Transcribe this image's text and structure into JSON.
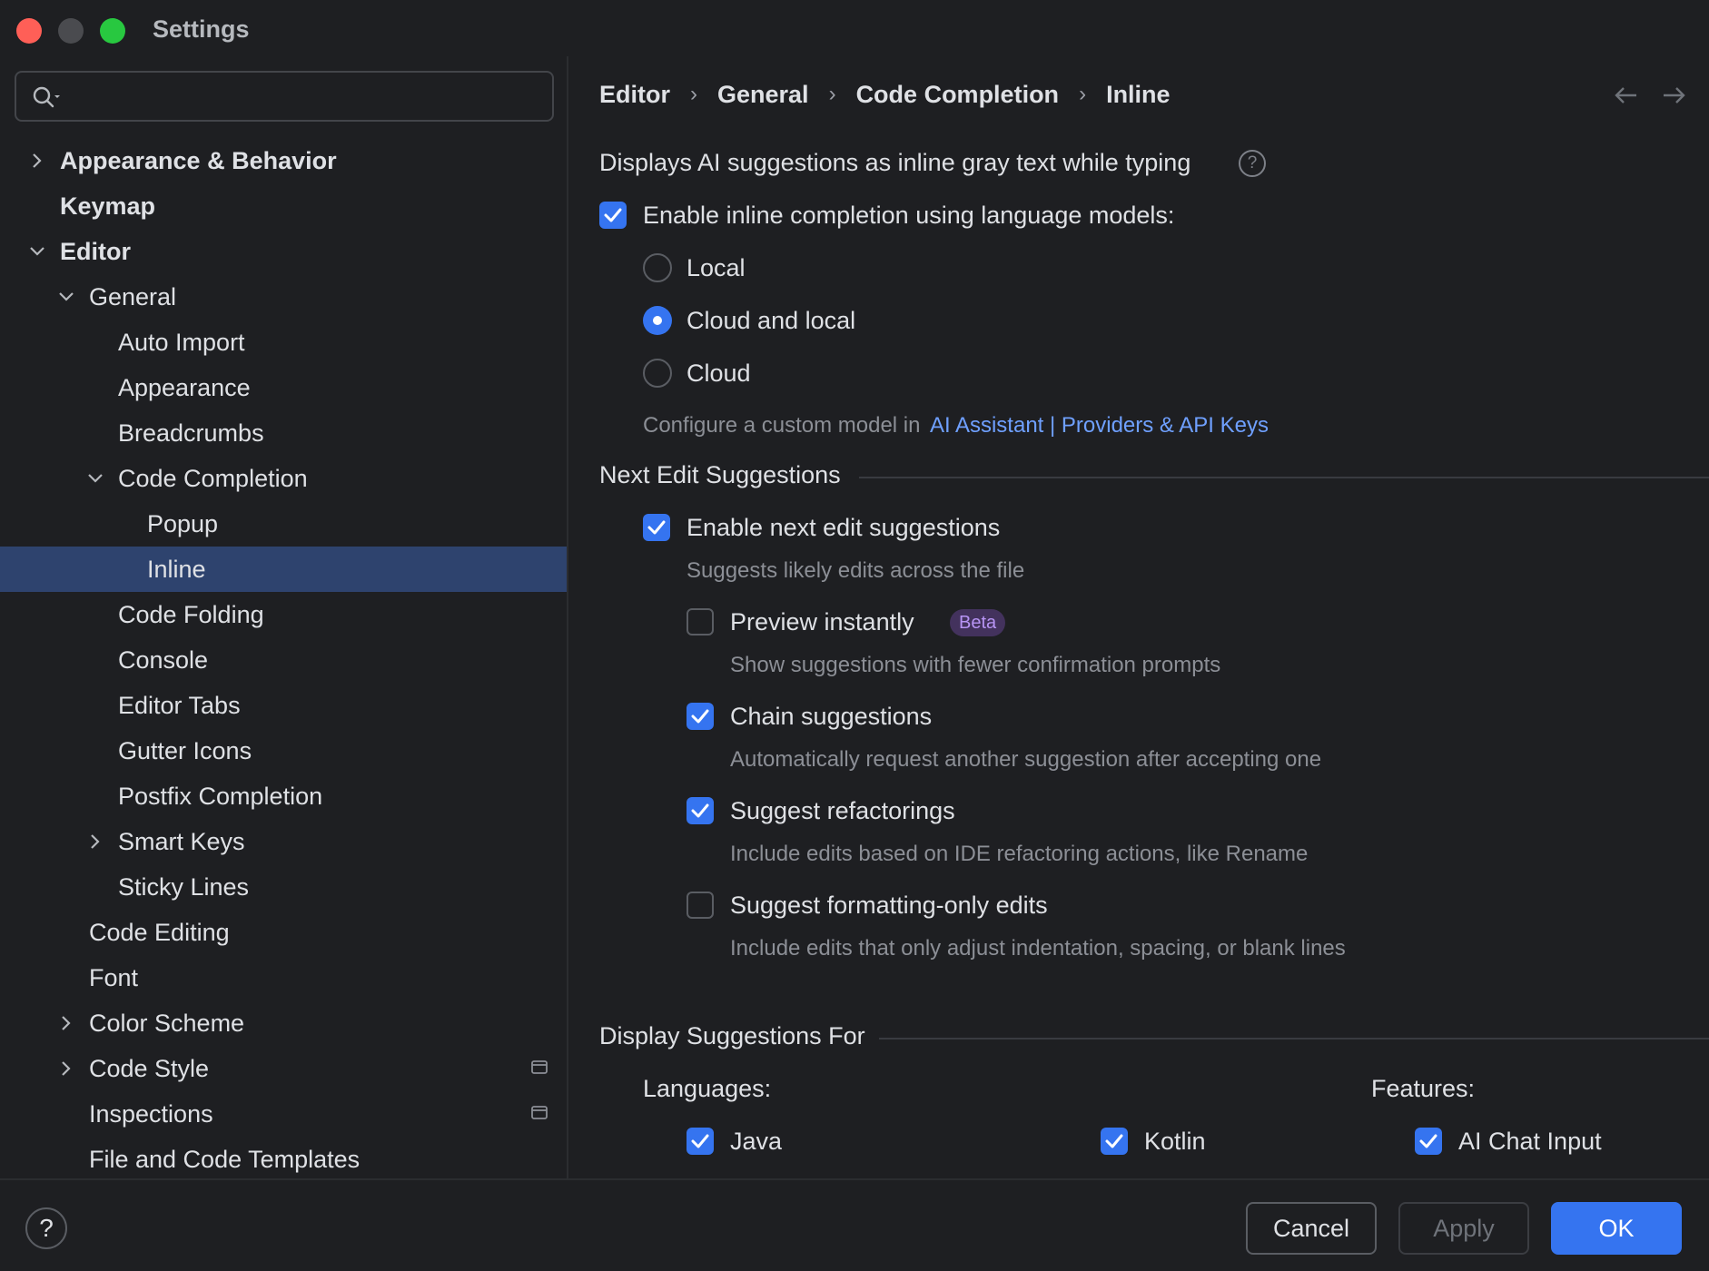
{
  "window": {
    "title": "Settings"
  },
  "search": {
    "placeholder": "",
    "value": ""
  },
  "tree": [
    {
      "label": "Appearance & Behavior",
      "bold": true,
      "expanded": false,
      "hasChildren": true,
      "depth": 0
    },
    {
      "label": "Keymap",
      "bold": true,
      "hasChildren": false,
      "depth": 0
    },
    {
      "label": "Editor",
      "bold": true,
      "expanded": true,
      "hasChildren": true,
      "depth": 0
    },
    {
      "label": "General",
      "expanded": true,
      "hasChildren": true,
      "depth": 1
    },
    {
      "label": "Auto Import",
      "depth": 2
    },
    {
      "label": "Appearance",
      "depth": 2
    },
    {
      "label": "Breadcrumbs",
      "depth": 2
    },
    {
      "label": "Code Completion",
      "expanded": true,
      "hasChildren": true,
      "depth": 2
    },
    {
      "label": "Popup",
      "depth": 3
    },
    {
      "label": "Inline",
      "depth": 3,
      "selected": true
    },
    {
      "label": "Code Folding",
      "depth": 2
    },
    {
      "label": "Console",
      "depth": 2
    },
    {
      "label": "Editor Tabs",
      "depth": 2
    },
    {
      "label": "Gutter Icons",
      "depth": 2
    },
    {
      "label": "Postfix Completion",
      "depth": 2
    },
    {
      "label": "Smart Keys",
      "expanded": false,
      "hasChildren": true,
      "depth": 2
    },
    {
      "label": "Sticky Lines",
      "depth": 2
    },
    {
      "label": "Code Editing",
      "depth": 1
    },
    {
      "label": "Font",
      "depth": 1
    },
    {
      "label": "Color Scheme",
      "expanded": false,
      "hasChildren": true,
      "depth": 1
    },
    {
      "label": "Code Style",
      "expanded": false,
      "hasChildren": true,
      "depth": 1,
      "projectIcon": true
    },
    {
      "label": "Inspections",
      "depth": 1,
      "projectIcon": true
    },
    {
      "label": "File and Code Templates",
      "depth": 1
    }
  ],
  "breadcrumbs": [
    "Editor",
    "General",
    "Code Completion",
    "Inline"
  ],
  "content": {
    "description": "Displays AI suggestions as inline gray text while typing",
    "enable_inline": {
      "label": "Enable inline completion using language models:",
      "checked": true
    },
    "model_options": [
      {
        "label": "Local",
        "selected": false
      },
      {
        "label": "Cloud and local",
        "selected": true
      },
      {
        "label": "Cloud",
        "selected": false
      }
    ],
    "custom_model_prefix": "Configure a custom model in",
    "custom_model_link": "AI Assistant | Providers & API Keys",
    "nes_section_title": "Next Edit Suggestions",
    "nes_enable": {
      "label": "Enable next edit suggestions",
      "checked": true,
      "hint": "Suggests likely edits across the file"
    },
    "nes_options": [
      {
        "label": "Preview instantly",
        "checked": false,
        "badge": "Beta",
        "hint": "Show suggestions with fewer confirmation prompts"
      },
      {
        "label": "Chain suggestions",
        "checked": true,
        "hint": "Automatically request another suggestion after accepting one"
      },
      {
        "label": "Suggest refactorings",
        "checked": true,
        "hint": "Include edits based on IDE refactoring actions, like Rename"
      },
      {
        "label": "Suggest formatting-only edits",
        "checked": false,
        "hint": "Include edits that only adjust indentation, spacing, or blank lines"
      }
    ],
    "display_section_title": "Display Suggestions For",
    "languages_label": "Languages:",
    "features_label": "Features:",
    "languages": [
      {
        "label": "Java",
        "checked": true
      },
      {
        "label": "Kotlin",
        "checked": true
      }
    ],
    "features": [
      {
        "label": "AI Chat Input",
        "checked": true
      }
    ]
  },
  "footer": {
    "help": "?",
    "cancel": "Cancel",
    "apply": "Apply",
    "ok": "OK"
  },
  "colors": {
    "accent": "#3574f0",
    "selection": "#2e436e",
    "link": "#6fa0ff",
    "badge_bg": "#43325d",
    "badge_fg": "#b794f4"
  }
}
